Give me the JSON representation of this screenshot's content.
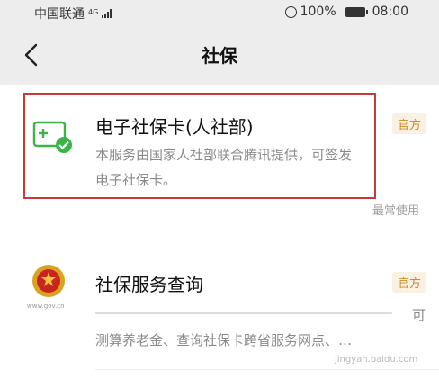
{
  "status_bar": {
    "carrier": "中国联通",
    "network": "4G",
    "battery": "100%",
    "time": "08:00"
  },
  "nav": {
    "title": "社保"
  },
  "services": [
    {
      "title": "电子社保卡(人社部)",
      "badge": "官方",
      "desc_line1": "本服务由国家人社部联合腾讯提供，可签发",
      "desc_line2": "电子社保卡。",
      "note": "最常使用"
    },
    {
      "title": "社保服务查询",
      "badge": "官方",
      "desc_line1_tail": "可",
      "desc_line2": "测算养老金、查询社保卡跨省服务网点、…",
      "logo_caption": "www.gov.cn"
    }
  ],
  "watermark": "jingyan.baidu.com",
  "colors": {
    "highlight": "#c63a3a",
    "accent_green": "#3bb34a",
    "badge": "#d08b2a"
  }
}
